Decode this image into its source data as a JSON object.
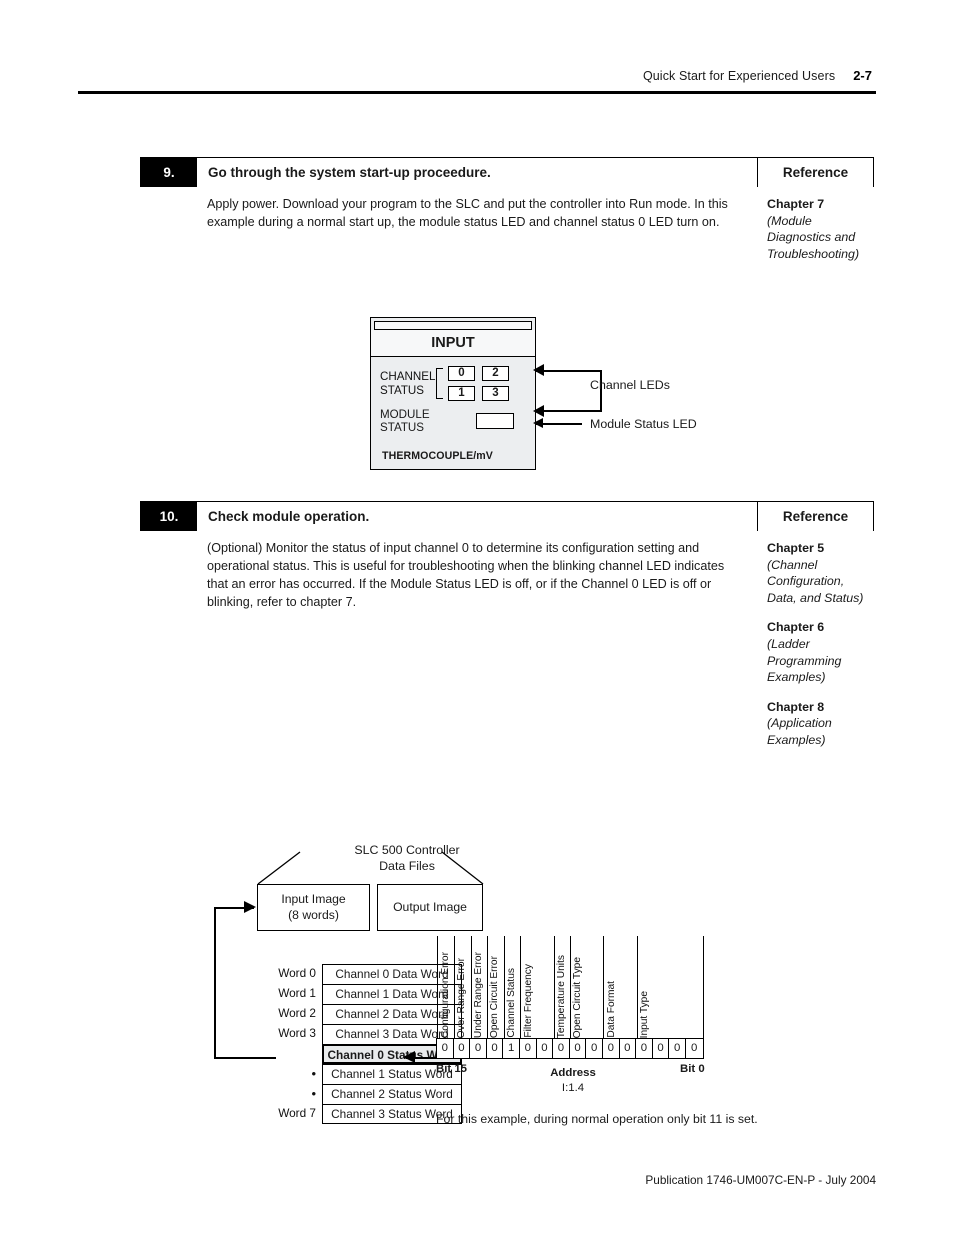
{
  "header": {
    "title": "Quick Start for Experienced Users",
    "page_number": "2-7"
  },
  "steps": [
    {
      "number": "9.",
      "title": "Go through the system start-up proceedure.",
      "reference_header": "Reference",
      "description": "Apply power. Download your program to the SLC and put the controller into Run mode. In this example during a normal start up, the module status LED and channel status 0 LED turn on.",
      "references": [
        {
          "chapter": "Chapter 7",
          "subtitle": "(Module Diagnostics and Troubleshooting)"
        }
      ]
    },
    {
      "number": "10.",
      "title": "Check module operation.",
      "reference_header": "Reference",
      "description": "(Optional) Monitor the status of input channel 0 to determine its configuration setting and operational status. This is useful for troubleshooting when the blinking channel LED indicates that an error has occurred. If the Module Status LED is off, or if the Channel 0 LED is off or blinking, refer to chapter 7.",
      "references": [
        {
          "chapter": "Chapter 5",
          "subtitle": "(Channel Configuration, Data, and Status)"
        },
        {
          "chapter": "Chapter 6",
          "subtitle": "(Ladder Programming Examples)"
        },
        {
          "chapter": "Chapter 8",
          "subtitle": "(Application Examples)"
        }
      ]
    }
  ],
  "module_figure": {
    "input_label": "INPUT",
    "channel_status_line1": "CHANNEL",
    "channel_status_line2": "STATUS",
    "leds": [
      "0",
      "2",
      "1",
      "3"
    ],
    "module_status_label": "MODULE STATUS",
    "thermocouple_label": "THERMOCOUPLE/mV",
    "callout_channel_leds": "Channel LEDs",
    "callout_module_status_led": "Module Status LED"
  },
  "data_figure": {
    "slc_title_line1": "SLC 500 Controller",
    "slc_title_line2": "Data Files",
    "input_image_line1": "Input Image",
    "input_image_line2": "(8 words)",
    "output_image": "Output Image",
    "word_rows": [
      {
        "label": "Word 0",
        "cell": "Channel 0 Data Word",
        "highlight": false
      },
      {
        "label": "Word 1",
        "cell": "Channel 1 Data Word",
        "highlight": false
      },
      {
        "label": "Word 2",
        "cell": "Channel 2 Data Word",
        "highlight": false
      },
      {
        "label": "Word 3",
        "cell": "Channel 3 Data Word",
        "highlight": false
      },
      {
        "label": "",
        "cell": "Channel 0 Status Word",
        "highlight": true
      },
      {
        "label": "•",
        "cell": "Channel 1 Status Word",
        "highlight": false
      },
      {
        "label": "•",
        "cell": "Channel 2 Status Word",
        "highlight": false
      },
      {
        "label": "Word 7",
        "cell": "Channel 3 Status Word",
        "highlight": false
      }
    ],
    "bit_groups": [
      {
        "label": "Configuration Error",
        "span": 1
      },
      {
        "label": "Over Range Error",
        "span": 1
      },
      {
        "label": "Under Range Error",
        "span": 1
      },
      {
        "label": "Open Circuit Error",
        "span": 1
      },
      {
        "label": "Channel Status",
        "span": 1
      },
      {
        "label": "Filter Frequency",
        "span": 2
      },
      {
        "label": "Temperature Units",
        "span": 1
      },
      {
        "label": "Open Circuit Type",
        "span": 2
      },
      {
        "label": "Data Format",
        "span": 2
      },
      {
        "label": "Input Type",
        "span": 4
      }
    ],
    "bit_values": [
      "0",
      "0",
      "0",
      "0",
      "1",
      "0",
      "0",
      "0",
      "0",
      "0",
      "0",
      "0",
      "0",
      "0",
      "0",
      "0"
    ],
    "bit15_label": "Bit 15",
    "bit0_label": "Bit 0",
    "address_label": "Address",
    "address_value": "I:1.4",
    "example_note": "For this example, during normal operation only bit 11 is set."
  },
  "footer": {
    "publication": "Publication 1746-UM007C-EN-P - July 2004"
  }
}
